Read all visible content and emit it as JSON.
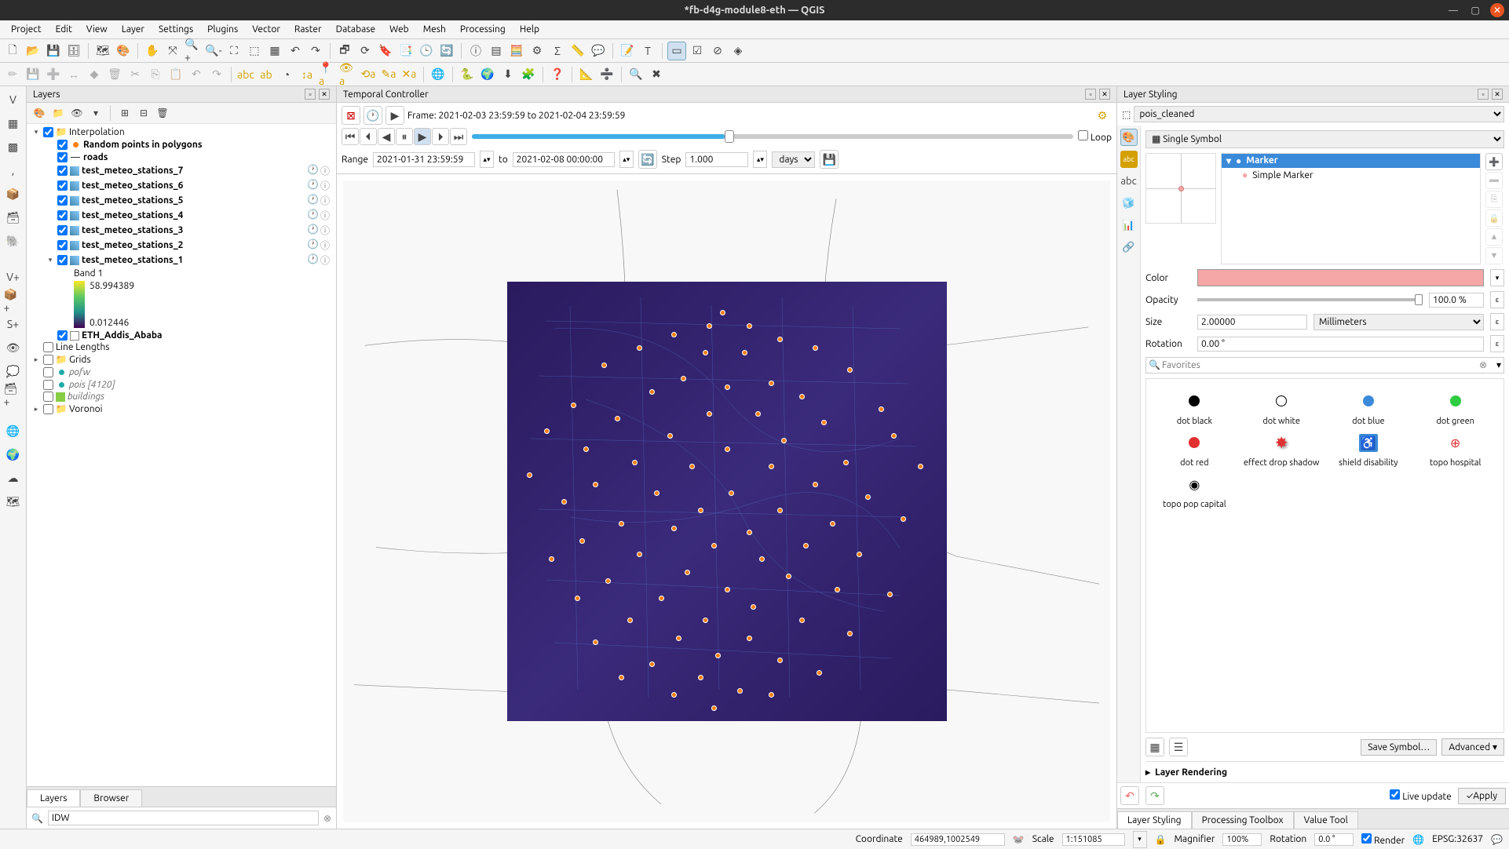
{
  "window": {
    "title": "*fb-d4g-module8-eth — QGIS"
  },
  "menu": [
    "Project",
    "Edit",
    "View",
    "Layer",
    "Settings",
    "Plugins",
    "Vector",
    "Raster",
    "Database",
    "Web",
    "Mesh",
    "Processing",
    "Help"
  ],
  "layers_panel": {
    "title": "Layers",
    "tabs": [
      "Layers",
      "Browser"
    ],
    "active_tab": 0,
    "search": "IDW",
    "tree": [
      {
        "t": "group",
        "name": "Interpolation",
        "checked": true,
        "expanded": true
      },
      {
        "t": "layer",
        "name": "Random points in polygons",
        "checked": true,
        "bold": true,
        "indent": 1,
        "sym": "orange-dot"
      },
      {
        "t": "layer",
        "name": "roads",
        "checked": true,
        "bold": true,
        "indent": 1,
        "sym": "line"
      },
      {
        "t": "layer",
        "name": "test_meteo_stations_7",
        "checked": true,
        "bold": true,
        "indent": 1,
        "sym": "raster",
        "badges": true
      },
      {
        "t": "layer",
        "name": "test_meteo_stations_6",
        "checked": true,
        "bold": true,
        "indent": 1,
        "sym": "raster",
        "badges": true
      },
      {
        "t": "layer",
        "name": "test_meteo_stations_5",
        "checked": true,
        "bold": true,
        "indent": 1,
        "sym": "raster",
        "badges": true
      },
      {
        "t": "layer",
        "name": "test_meteo_stations_4",
        "checked": true,
        "bold": true,
        "indent": 1,
        "sym": "raster",
        "badges": true
      },
      {
        "t": "layer",
        "name": "test_meteo_stations_3",
        "checked": true,
        "bold": true,
        "indent": 1,
        "sym": "raster",
        "badges": true
      },
      {
        "t": "layer",
        "name": "test_meteo_stations_2",
        "checked": true,
        "bold": true,
        "indent": 1,
        "sym": "raster",
        "badges": true
      },
      {
        "t": "layer",
        "name": "test_meteo_stations_1",
        "checked": true,
        "bold": true,
        "indent": 1,
        "sym": "raster",
        "expanded": true,
        "badges": true
      },
      {
        "t": "band",
        "name": "Band 1",
        "max": "58.994389",
        "min": "0.012446",
        "indent": 2
      },
      {
        "t": "layer",
        "name": "ETH_Addis_Ababa",
        "checked": true,
        "bold": true,
        "indent": 1,
        "sym": "poly"
      },
      {
        "t": "layer",
        "name": "Line Lengths",
        "checked": false,
        "indent": 0
      },
      {
        "t": "group",
        "name": "Grids",
        "checked": false,
        "expanded": false
      },
      {
        "t": "layer",
        "name": "pofw",
        "checked": false,
        "italic": true,
        "indent": 0,
        "sym": "teal-dot"
      },
      {
        "t": "layer",
        "name": "pois [4120]",
        "checked": false,
        "italic": true,
        "indent": 0,
        "sym": "teal-dot"
      },
      {
        "t": "layer",
        "name": "buildings",
        "checked": false,
        "italic": true,
        "indent": 0,
        "sym": "green-sq"
      },
      {
        "t": "group",
        "name": "Voronoi",
        "checked": false,
        "expanded": false
      }
    ]
  },
  "temporal": {
    "title": "Temporal Controller",
    "frame_label": "Frame: 2021-02-03 23:59:59 to 2021-02-04 23:59:59",
    "range_label": "Range",
    "range_from": "2021-01-31 23:59:59",
    "to_label": "to",
    "range_to": "2021-02-08 00:00:00",
    "step_label": "Step",
    "step_value": "1.000",
    "step_unit": "days",
    "loop_label": "Loop"
  },
  "styling": {
    "title": "Layer Styling",
    "layer_select": "pois_cleaned",
    "symbol_mode": "Single Symbol",
    "tree": {
      "root": "Marker",
      "child": "Simple Marker"
    },
    "color_label": "Color",
    "color_value": "#f5a6a6",
    "opacity_label": "Opacity",
    "opacity_value": "100.0 %",
    "size_label": "Size",
    "size_value": "2.00000",
    "size_unit": "Millimeters",
    "rotation_label": "Rotation",
    "rotation_value": "0.00 °",
    "search_placeholder": "Favorites",
    "favorites": [
      {
        "id": "dot-black",
        "label": "dot  black",
        "fill": "#000"
      },
      {
        "id": "dot-white",
        "label": "dot  white",
        "fill": "#fff",
        "stroke": "#000"
      },
      {
        "id": "dot-blue",
        "label": "dot blue",
        "fill": "#3b8ad9"
      },
      {
        "id": "dot-green",
        "label": "dot green",
        "fill": "#2ecc40"
      },
      {
        "id": "dot-red",
        "label": "dot red",
        "fill": "#e03030"
      },
      {
        "id": "effect-drop-shadow",
        "label": "effect drop shadow",
        "fill": "#e03030",
        "star": true
      },
      {
        "id": "shield-disability",
        "label": "shield disability",
        "glyph": "♿",
        "gbg": "#3b8ad9"
      },
      {
        "id": "topo-hospital",
        "label": "topo hospital",
        "glyph": "⊕",
        "gc": "#e03030"
      },
      {
        "id": "topo-pop-capital",
        "label": "topo pop capital",
        "glyph": "◉"
      }
    ],
    "save_symbol": "Save Symbol…",
    "advanced": "Advanced",
    "layer_rendering": "Layer Rendering",
    "live_update": "Live update",
    "apply": "Apply",
    "tabs": [
      "Layer Styling",
      "Processing Toolbox",
      "Value Tool"
    ]
  },
  "statusbar": {
    "coord_label": "Coordinate",
    "coord": "464989,1002549",
    "scale_label": "Scale",
    "scale": "1:151085",
    "magnifier_label": "Magnifier",
    "magnifier": "100%",
    "rotation_label": "Rotation",
    "rotation": "0.0 °",
    "render": "Render",
    "crs": "EPSG:32637"
  }
}
